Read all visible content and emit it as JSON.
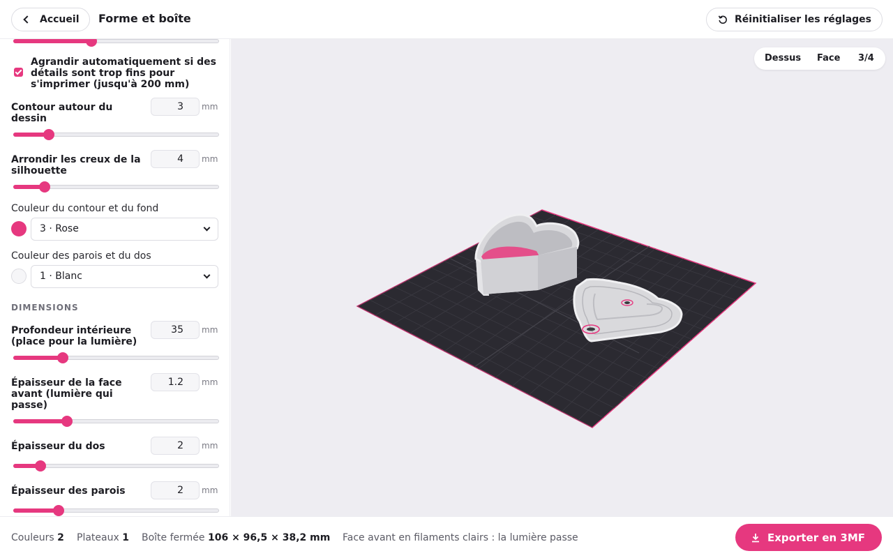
{
  "header": {
    "back_label": "Accueil",
    "title": "Forme et boîte",
    "reset_label": "Réinitialiser les réglages"
  },
  "sidebar": {
    "top_slider_value": 0.38,
    "auto_enlarge": {
      "checked": true,
      "label_line1": "Agrandir automatiquement si des",
      "label_line2": "détails sont trop fins pour",
      "label_line3": "s'imprimer (jusqu'à 200 mm)"
    },
    "contour": {
      "label_line1": "Contour autour du",
      "label_line2": "dessin",
      "value": "3",
      "unit": "mm",
      "slider": 0.17
    },
    "round_hollows": {
      "label_line1": "Arrondir les creux de la",
      "label_line2": "silhouette",
      "value": "4",
      "unit": "mm",
      "slider": 0.15
    },
    "outline_color": {
      "label": "Couleur du contour et du fond",
      "value": "3 · Rose",
      "swatch": "#e6387f"
    },
    "wall_color": {
      "label": "Couleur des parois et du dos",
      "value": "1 · Blanc",
      "swatch": "#f6f6f8"
    },
    "dimensions_title": "DIMENSIONS",
    "inner_depth": {
      "label_line1": "Profondeur intérieure",
      "label_line2": "(place pour la lumière)",
      "value": "35",
      "unit": "mm",
      "slider": 0.24
    },
    "front_thickness": {
      "label_line1": "Épaisseur de la face",
      "label_line2": "avant (lumière qui",
      "label_line3": "passe)",
      "value": "1.2",
      "unit": "mm",
      "slider": 0.26
    },
    "back_thickness": {
      "label": "Épaisseur du dos",
      "value": "2",
      "unit": "mm",
      "slider": 0.13
    },
    "wall_thickness": {
      "label": "Épaisseur des parois",
      "value": "2",
      "unit": "mm",
      "slider": 0.22
    }
  },
  "viewport": {
    "views": [
      "Dessus",
      "Face",
      "3/4"
    ],
    "active_view": "3/4",
    "plate_color": "#2a2a30",
    "accent": "#e6387f"
  },
  "footer": {
    "colors_label": "Couleurs",
    "colors_value": "2",
    "plates_label": "Plateaux",
    "plates_value": "1",
    "box_label": "Boîte fermée",
    "box_value": "106 × 96,5 × 38,2 mm",
    "note": "Face avant en filaments clairs : la lumière passe",
    "export_label": "Exporter en 3MF"
  }
}
